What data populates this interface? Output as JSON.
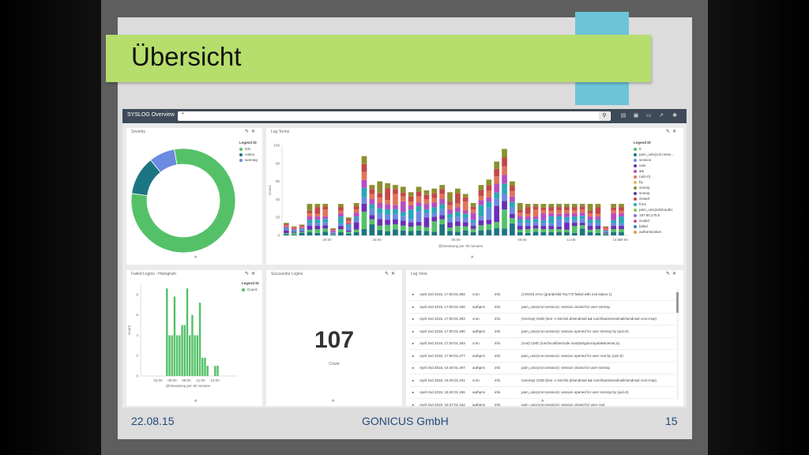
{
  "slide": {
    "title": "Übersicht",
    "footer_date": "22.08.15",
    "footer_company": "GONICUS GmbH",
    "footer_page": "15",
    "accent_green": "#b6de6c",
    "accent_teal": "#6cc4d6"
  },
  "dashboard": {
    "title": "SYSLOG Overview",
    "query": "*",
    "icons": [
      "search-icon",
      "new-icon",
      "save-icon",
      "open-icon",
      "share-icon",
      "settings-icon"
    ]
  },
  "severity": {
    "title": "Severity",
    "legend_title": "Legend ID",
    "legend": [
      {
        "label": "info",
        "color": "#54c168",
        "value": 0.8
      },
      {
        "label": "notice",
        "color": "#1c7582",
        "value": 0.12
      },
      {
        "label": "warning",
        "color": "#6c8ae0",
        "value": 0.08
      }
    ]
  },
  "log_terms": {
    "title": "Log Terms",
    "legend_title": "Legend ID",
    "xlabel": "@timestamp per 30 minutes",
    "ylabel": "Count",
    "y_ticks": [
      "0",
      "20",
      "40",
      "60",
      "80",
      "100"
    ],
    "x_ticks": [
      "20:00",
      "23:00",
      "05:00",
      "08:00",
      "11:00",
      "14:00",
      "17:00"
    ],
    "legend": [
      {
        "label": "0",
        "color": "#54c168"
      },
      {
        "label": "pam_unix(cron:sess...",
        "color": "#1c7582"
      },
      {
        "label": "session",
        "color": "#6c8ae0"
      },
      {
        "label": "user",
        "color": "#6a2fb6"
      },
      {
        "label": "&&",
        "color": "#b64ec1"
      },
      {
        "label": "(uid=0)",
        "color": "#e0745a"
      },
      {
        "label": "by",
        "color": "#e8b95c"
      },
      {
        "label": "snmnp",
        "color": "#8c8f2f"
      },
      {
        "label": "snmnp",
        "color": "#5c3a9c"
      },
      {
        "label": "closed",
        "color": "#c24848"
      },
      {
        "label": "from",
        "color": "#29a8b5"
      },
      {
        "label": "pam_unix(sshd:authc",
        "color": "#7fc65a"
      },
      {
        "label": "197.60.175.5",
        "color": "#9a6ad6"
      },
      {
        "label": "invalid",
        "color": "#d6508e"
      },
      {
        "label": "failed",
        "color": "#3c7fc8"
      },
      {
        "label": "authentication",
        "color": "#e09a3a"
      }
    ]
  },
  "failed_logins": {
    "title": "Failed Logins - Histogram",
    "legend_title": "Legend ID",
    "legend": [
      {
        "label": "Count",
        "color": "#54c168"
      }
    ],
    "xlabel": "@timestamp per 30 minutes",
    "ylabel": "Count",
    "y_ticks": [
      "0",
      "2",
      "4",
      "6",
      "8"
    ],
    "x_ticks": [
      "02:00",
      "05:00",
      "08:00",
      "11:00",
      "14:00"
    ]
  },
  "successful_logins": {
    "title": "Successful Logins",
    "value": "107",
    "label": "Count"
  },
  "log_view": {
    "title": "Log View",
    "rows": [
      {
        "date": "April 2nd 2015, 17:00:01.882",
        "host": "cron",
        "level": "info",
        "msg": "(CRON) error (grandchild #11770 failed with exit status 1)"
      },
      {
        "date": "April 2nd 2015, 17:00:01.460",
        "host": "authpriv",
        "level": "info",
        "msg": "pam_unix(cron:session): session closed for user smmsp"
      },
      {
        "date": "April 2nd 2015, 17:00:01.293",
        "host": "cron",
        "level": "info",
        "msg": "(smmsp) CMD (test -x /etc/init.d/sendmail && /usr/share/sendmail/sendmail cron-msp)"
      },
      {
        "date": "April 2nd 2015, 17:00:01.290",
        "host": "authpriv",
        "level": "info",
        "msg": "pam_unix(cron:session): session opened for user smmsp by (uid=0)"
      },
      {
        "date": "April 2nd 2015, 17:00:01.283",
        "host": "cron",
        "level": "info",
        "msg": "(root) CMD (/usr/local/bin/node /var/partypics/updateEvents.js)"
      },
      {
        "date": "April 2nd 2015, 17:00:01.277",
        "host": "authpriv",
        "level": "info",
        "msg": "pam_unix(cron:session): session opened for user root by (uid=0)"
      },
      {
        "date": "April 2nd 2015, 16:40:01.297",
        "host": "authpriv",
        "level": "info",
        "msg": "pam_unix(cron:session): session closed for user smmsp"
      },
      {
        "date": "April 2nd 2015, 16:40:01.191",
        "host": "cron",
        "level": "info",
        "msg": "(smmsp) CMD (test -x /etc/init.d/sendmail && /usr/share/sendmail/sendmail cron-msp)"
      },
      {
        "date": "April 2nd 2015, 16:40:01.186",
        "host": "authpriv",
        "level": "info",
        "msg": "pam_unix(cron:session): session opened for user smmsp by (uid=0)"
      },
      {
        "date": "April 2nd 2015, 16:27:01.162",
        "host": "authpriv",
        "level": "info",
        "msg": "pam_unix(cron:session): session closed for user root"
      }
    ]
  },
  "chart_data": [
    {
      "type": "pie",
      "title": "Severity",
      "categories": [
        "info",
        "notice",
        "warning"
      ],
      "values": [
        80,
        12,
        8
      ]
    },
    {
      "type": "bar",
      "title": "Log Terms",
      "stacked": true,
      "xlabel": "@timestamp per 30 minutes",
      "ylabel": "Count",
      "ylim": [
        0,
        100
      ],
      "series_colors": [
        "#1c7582",
        "#54c168",
        "#6a2fb6",
        "#6c8ae0",
        "#29a8b5",
        "#b64ec1",
        "#e0745a",
        "#c24848",
        "#8c8f2f"
      ],
      "totals": [
        14,
        10,
        12,
        35,
        35,
        35,
        8,
        35,
        20,
        36,
        88,
        56,
        60,
        58,
        56,
        54,
        48,
        54,
        50,
        52,
        56,
        48,
        52,
        46,
        36,
        56,
        62,
        82,
        96,
        60,
        36,
        35,
        35,
        35,
        35,
        35,
        35,
        35,
        35,
        35,
        35,
        10,
        35,
        35
      ]
    },
    {
      "type": "bar",
      "title": "Failed Logins - Histogram",
      "xlabel": "@timestamp per 30 minutes",
      "ylabel": "Count",
      "ylim": [
        0,
        9
      ],
      "values": [
        0,
        0,
        0,
        0,
        0,
        0,
        0,
        0,
        0,
        0,
        8.6,
        4.0,
        4.0,
        7.8,
        4.0,
        4.0,
        5.0,
        5.0,
        8.6,
        4.0,
        6.0,
        4.0,
        4.0,
        7.2,
        1.8,
        1.8,
        1.0,
        0,
        0,
        1.0,
        1.0,
        0,
        0,
        0,
        0,
        0,
        0,
        0
      ]
    }
  ]
}
